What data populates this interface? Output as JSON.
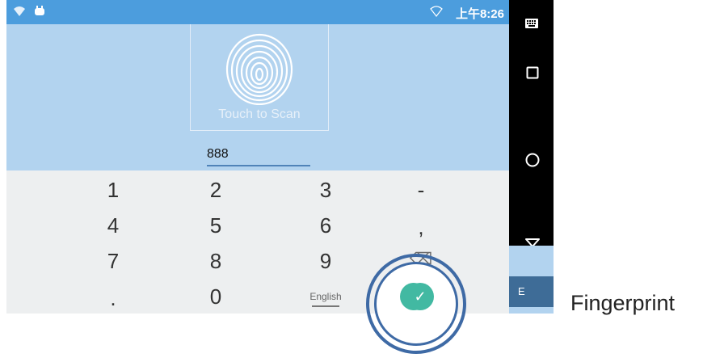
{
  "status_bar": {
    "time": "上午8:26"
  },
  "scanner": {
    "label": "Touch to Scan"
  },
  "pin_field": {
    "value": "888"
  },
  "keypad": {
    "rows": [
      [
        "1",
        "2",
        "3",
        "-"
      ],
      [
        "4",
        "5",
        "6",
        ","
      ],
      [
        "7",
        "8",
        "9",
        "⌫"
      ],
      [
        ".",
        "0",
        "English",
        "✓"
      ]
    ]
  },
  "side_panel": {
    "enter_label": "E"
  },
  "caption": "Fingerprint",
  "colors": {
    "status_bar": "#4c9ddd",
    "panel": "#b2d3ef",
    "keypad": "#edeff0",
    "confirm": "#42b9a2",
    "ring": "#3e6aa5"
  }
}
